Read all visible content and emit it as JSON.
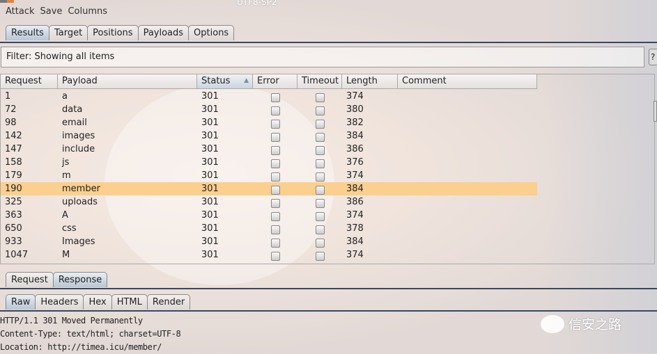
{
  "window": {
    "title": "UTF8-SP2"
  },
  "menu": [
    "Attack",
    "Save",
    "Columns"
  ],
  "tabs": [
    "Results",
    "Target",
    "Positions",
    "Payloads",
    "Options"
  ],
  "filter": "Filter: Showing all items",
  "help": "?",
  "columns": [
    "Request",
    "Payload",
    "Status",
    "Error",
    "Timeout",
    "Length",
    "Comment"
  ],
  "rows": [
    {
      "request": "1",
      "payload": "a",
      "status": "301",
      "length": "374"
    },
    {
      "request": "72",
      "payload": "data",
      "status": "301",
      "length": "380"
    },
    {
      "request": "98",
      "payload": "email",
      "status": "301",
      "length": "382"
    },
    {
      "request": "142",
      "payload": "images",
      "status": "301",
      "length": "384"
    },
    {
      "request": "147",
      "payload": "include",
      "status": "301",
      "length": "386"
    },
    {
      "request": "158",
      "payload": "js",
      "status": "301",
      "length": "376"
    },
    {
      "request": "179",
      "payload": "m",
      "status": "301",
      "length": "374"
    },
    {
      "request": "190",
      "payload": "member",
      "status": "301",
      "length": "384"
    },
    {
      "request": "325",
      "payload": "uploads",
      "status": "301",
      "length": "386"
    },
    {
      "request": "363",
      "payload": "A",
      "status": "301",
      "length": "374"
    },
    {
      "request": "650",
      "payload": "css",
      "status": "301",
      "length": "378"
    },
    {
      "request": "933",
      "payload": "Images",
      "status": "301",
      "length": "384"
    },
    {
      "request": "1047",
      "payload": "M",
      "status": "301",
      "length": "374"
    }
  ],
  "selected_row": 7,
  "message_tabs": [
    "Request",
    "Response"
  ],
  "view_tabs": [
    "Raw",
    "Headers",
    "Hex",
    "HTML",
    "Render"
  ],
  "response_lines": [
    "HTTP/1.1 301 Moved Permanently",
    "Content-Type: text/html; charset=UTF-8",
    "Location: http://timea.icu/member/"
  ],
  "watermark": "信安之路"
}
